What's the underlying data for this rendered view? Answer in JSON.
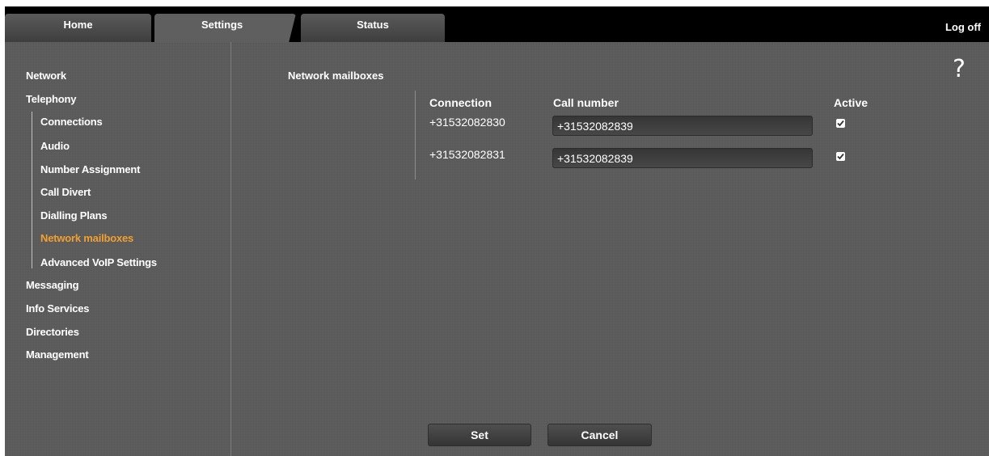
{
  "tabs": {
    "home": "Home",
    "settings": "Settings",
    "status": "Status"
  },
  "logoff": "Log off",
  "help": "?",
  "sidebar": {
    "network": "Network",
    "telephony": "Telephony",
    "connections": "Connections",
    "audio": "Audio",
    "number_assignment": "Number Assignment",
    "call_divert": "Call Divert",
    "dialling_plans": "Dialling Plans",
    "network_mailboxes": "Network mailboxes",
    "advanced_voip": "Advanced VoIP Settings",
    "messaging": "Messaging",
    "info_services": "Info Services",
    "directories": "Directories",
    "management": "Management"
  },
  "main": {
    "title": "Network mailboxes",
    "headers": {
      "connection": "Connection",
      "call_number": "Call number",
      "active": "Active"
    },
    "rows": [
      {
        "connection": "+31532082830",
        "call_number": "+31532082839",
        "active": true
      },
      {
        "connection": "+31532082831",
        "call_number": "+31532082839",
        "active": true
      }
    ]
  },
  "buttons": {
    "set": "Set",
    "cancel": "Cancel"
  },
  "colors": {
    "active_nav": "#f0a030",
    "panel": "#5b5b5b",
    "topbar": "#000000"
  }
}
